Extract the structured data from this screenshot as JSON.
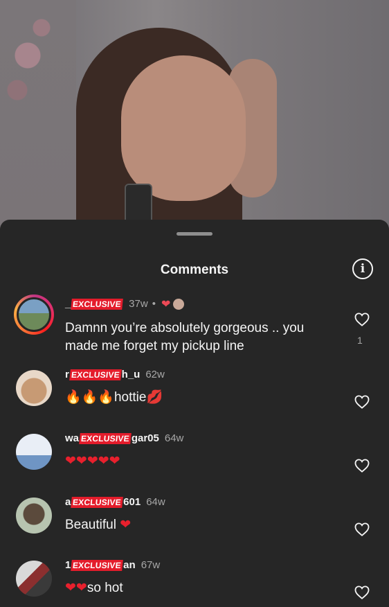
{
  "sheet": {
    "title": "Comments",
    "info_icon": "i"
  },
  "comments": [
    {
      "user_prefix": "_",
      "user_tag": "EXCLUSIVE",
      "user_suffix": "",
      "time": "37w",
      "dot": "•",
      "liked_by_author": true,
      "liked_heart": "❤",
      "text": "Damnn you’re absolutely gorgeous .. you made me forget my pickup line",
      "like_count": "1",
      "story_ring": true
    },
    {
      "user_prefix": "r",
      "user_tag": "EXCLUSIVE",
      "user_suffix": "h_u",
      "time": "62w",
      "text_emoji_prefix": "🔥🔥🔥",
      "text": "hottie",
      "text_emoji_suffix": "💋"
    },
    {
      "user_prefix": "wa",
      "user_tag": "EXCLUSIVE",
      "user_suffix": "gar05",
      "time": "64w",
      "text": "❤❤❤❤❤"
    },
    {
      "user_prefix": "a",
      "user_tag": "EXCLUSIVE",
      "user_suffix": "601",
      "time": "64w",
      "text": "Beautiful",
      "text_emoji_suffix": "❤"
    },
    {
      "user_prefix": "1",
      "user_tag": "EXCLUSIVE",
      "user_suffix": "an",
      "time": "67w",
      "text_emoji_prefix": "❤❤",
      "text": "so hot"
    }
  ],
  "colors": {
    "sheet_bg": "#262626",
    "like_red": "#ed4956",
    "tag_red": "#e41c2b",
    "muted": "#a8a8a8"
  },
  "icons": {
    "like": "heart-outline-icon",
    "info": "info-icon",
    "handle": "drag-handle"
  }
}
